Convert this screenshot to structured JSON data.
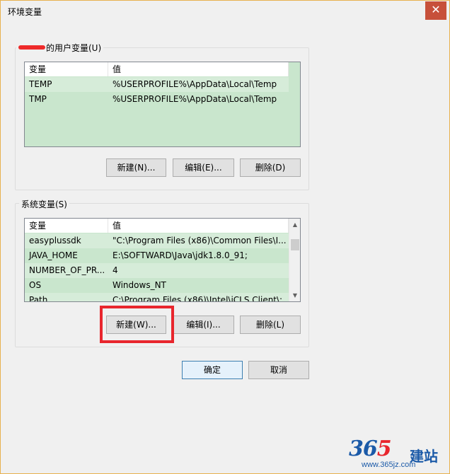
{
  "window": {
    "title": "环境变量",
    "close_glyph": "✕"
  },
  "user_vars": {
    "group_label": "的用户变量(U)",
    "columns": [
      "变量",
      "值"
    ],
    "rows": [
      {
        "name": "TEMP",
        "value": "%USERPROFILE%\\AppData\\Local\\Temp"
      },
      {
        "name": "TMP",
        "value": "%USERPROFILE%\\AppData\\Local\\Temp"
      }
    ],
    "buttons": {
      "new": "新建(N)...",
      "edit": "编辑(E)...",
      "delete": "删除(D)"
    }
  },
  "system_vars": {
    "group_label": "系统变量(S)",
    "columns": [
      "变量",
      "值"
    ],
    "rows": [
      {
        "name": "easyplussdk",
        "value": "\"C:\\Program Files (x86)\\Common Files\\I..."
      },
      {
        "name": "JAVA_HOME",
        "value": "E:\\SOFTWARD\\Java\\jdk1.8.0_91;"
      },
      {
        "name": "NUMBER_OF_PR...",
        "value": "4"
      },
      {
        "name": "OS",
        "value": "Windows_NT"
      },
      {
        "name": "Path",
        "value": "C:\\Program Files (x86)\\Intel\\iCLS Client\\;..."
      }
    ],
    "buttons": {
      "new": "新建(W)...",
      "edit": "编辑(I)...",
      "delete": "删除(L)"
    }
  },
  "dialog_buttons": {
    "ok": "确定",
    "cancel": "取消"
  },
  "watermark": {
    "logo_3": "3",
    "logo_6": "6",
    "logo_5": "5",
    "logo_cn": "建站",
    "url": "www.365jz.com"
  },
  "colors": {
    "list_bg": "#c9e6cd",
    "highlight": "#e8262d",
    "window_border": "#e8b14f"
  }
}
